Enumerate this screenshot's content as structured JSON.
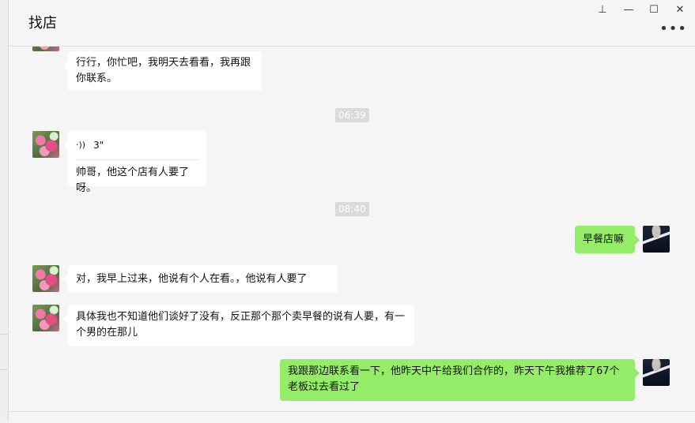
{
  "window": {
    "title": "找店",
    "pin_glyph": "⊥",
    "minimize_glyph": "—",
    "maximize_glyph": "☐",
    "close_glyph": "✕",
    "more_glyph": "•••"
  },
  "messages": {
    "m1": {
      "text": "行行，你忙吧，我明天去看看，我再跟你联系。"
    },
    "t1": "06:39",
    "m2": {
      "voice_glyph": "·))",
      "voice_duration": "3\"",
      "text": "帅哥，他这个店有人要了呀。"
    },
    "t2": "08:40",
    "m3": {
      "text": "早餐店嘛"
    },
    "m4": {
      "text": "对，我早上过来，他说有个人在看。，他说有人要了"
    },
    "m5": {
      "text": "具体我也不知道他们谈好了没有，反正那个那个卖早餐的说有人要，有一个男的在那儿"
    },
    "m6": {
      "text": "我跟那边联系看一下，他昨天中午给我们合作的，昨天下午我推荐了67个老板过去看过了"
    }
  }
}
